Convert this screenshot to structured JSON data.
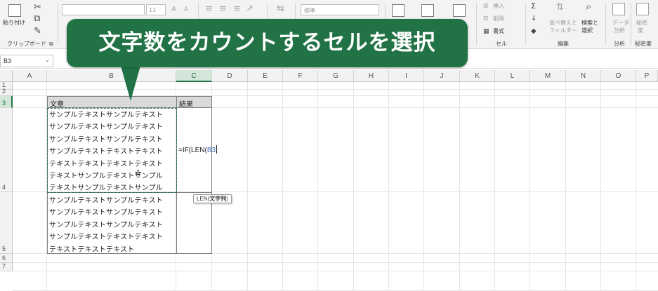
{
  "ribbon": {
    "paste_label": "貼り付け",
    "clipboard_group": "クリップボード",
    "font_size": "11",
    "number_format": "標準",
    "cells_group": "セル",
    "insert_label": "挿入",
    "delete_label": "削除",
    "format_label": "書式",
    "editing_group": "編集",
    "sort_filter_label1": "並べ替えと",
    "sort_filter_label2": "フィルター",
    "find_select_label1": "検索と",
    "find_select_label2": "選択",
    "analysis_label1": "データ",
    "analysis_label2": "分析",
    "analysis_group": "分析",
    "sensitivity_label1": "秘密",
    "sensitivity_label2": "度",
    "sensitivity_group": "秘密度"
  },
  "formula_bar": {
    "name_box": "B3"
  },
  "grid": {
    "columns": [
      "A",
      "B",
      "C",
      "D",
      "E",
      "F",
      "G",
      "H",
      "I",
      "J",
      "K",
      "L",
      "M",
      "N",
      "O",
      "P"
    ],
    "rows": [
      "1",
      "2",
      "3",
      "4",
      "5",
      "6",
      "7"
    ],
    "active_column": "C",
    "active_row": "3"
  },
  "table": {
    "header_text": "文章",
    "header_result": "結果",
    "b3_lines": [
      "サンプルテキストサンプルテキスト",
      "サンプルテキストサンプルテキスト",
      "サンプルテキストサンプルテキスト",
      "サンプルテキストテキストテキスト",
      "テキストテキストテキストテキスト",
      "テキストサンプルテキストサンプル",
      "テキストサンプルテキストサンプル"
    ],
    "b4_lines": [
      "サンプルテキストサンプルテキスト",
      "サンプルテキストサンプルテキスト",
      "サンプルテキストサンプルテキスト",
      "サンプルテキストテキストテキスト",
      "テキストテキストテキスト"
    ],
    "formula_prefix": "=IF(LEN(",
    "formula_ref": "B3",
    "tooltip_fn": "LEN(",
    "tooltip_arg": "文字列",
    "tooltip_close": ")"
  },
  "callout": {
    "text": "文字数をカウントするセルを選択"
  },
  "colors": {
    "accent": "#217346",
    "ref_blue": "#4472c4"
  }
}
